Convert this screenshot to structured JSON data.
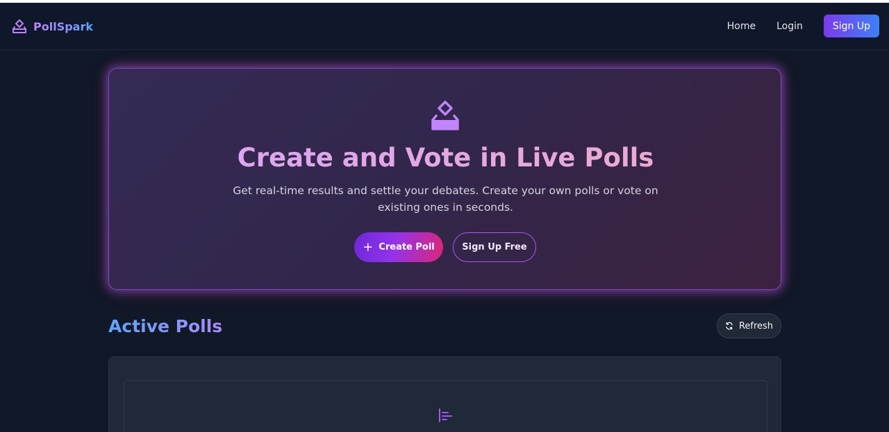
{
  "navbar": {
    "brand_name": "PollSpark",
    "brand_icon": "vote-box-icon",
    "links": [
      {
        "label": "Home"
      },
      {
        "label": "Login"
      }
    ],
    "signup_label": "Sign Up"
  },
  "hero": {
    "icon": "vote-box-icon",
    "title": "Create and Vote in Live Polls",
    "subtitle": "Get real-time results and settle your debates. Create your own polls or vote on existing ones in seconds.",
    "create_label": "Create Poll",
    "signup_free_label": "Sign Up Free"
  },
  "polls_section": {
    "title": "Active Polls",
    "refresh_label": "Refresh",
    "empty_icon": "bar-chart-icon"
  },
  "colors": {
    "background": "#111827",
    "navbar": "#0f172a",
    "accent_purple": "#a855f7",
    "accent_blue": "#3b82f6",
    "accent_pink": "#ec4899"
  }
}
